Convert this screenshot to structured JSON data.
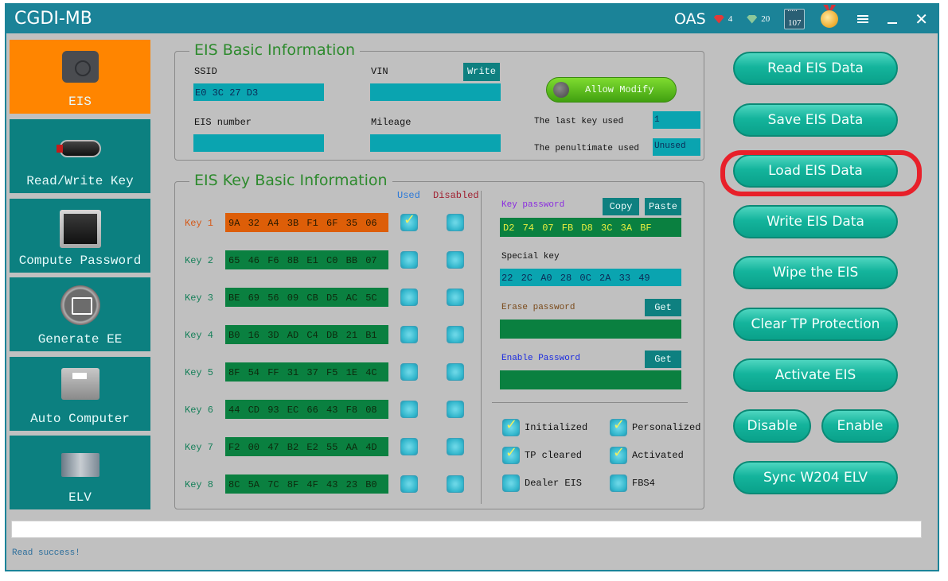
{
  "titlebar": {
    "title": "CGDI-MB",
    "account": "OAS",
    "red_gems": "4",
    "green_gems": "20",
    "calendar_days": "107"
  },
  "sidebar": {
    "items": [
      {
        "label": "EIS",
        "active": true
      },
      {
        "label": "Read/Write Key",
        "active": false
      },
      {
        "label": "Compute Password",
        "active": false
      },
      {
        "label": "Generate EE",
        "active": false
      },
      {
        "label": "Auto Computer",
        "active": false
      },
      {
        "label": "ELV",
        "active": false
      }
    ]
  },
  "basic_info": {
    "title": "EIS Basic Information",
    "ssid_label": "SSID",
    "ssid_value": "E0 3C 27 D3",
    "vin_label": "VIN",
    "vin_value": "",
    "write_button": "Write",
    "eis_number_label": "EIS number",
    "eis_number_value": "",
    "mileage_label": "Mileage",
    "mileage_value": "",
    "allow_modify": "Allow Modify",
    "last_key_label": "The last key used",
    "last_key_value": "1",
    "penultimate_label": "The penultimate used",
    "penultimate_value": "Unused"
  },
  "key_info": {
    "title": "EIS Key Basic Information",
    "used_header": "Used",
    "disabled_header": "Disabled",
    "keys": [
      {
        "label": "Key 1",
        "value": "9A 32 A4 3B F1 6F 35 06",
        "used": true,
        "disabled": false
      },
      {
        "label": "Key 2",
        "value": "65 46 F6 8B E1 C0 BB 07",
        "used": false,
        "disabled": false
      },
      {
        "label": "Key 3",
        "value": "BE 69 56 09 CB D5 AC 5C",
        "used": false,
        "disabled": false
      },
      {
        "label": "Key 4",
        "value": "B0 16 3D AD C4 DB 21 B1",
        "used": false,
        "disabled": false
      },
      {
        "label": "Key 5",
        "value": "8F 54 FF 31 37 F5 1E 4C",
        "used": false,
        "disabled": false
      },
      {
        "label": "Key 6",
        "value": "44 CD 93 EC 66 43 F8 08",
        "used": false,
        "disabled": false
      },
      {
        "label": "Key 7",
        "value": "F2 00 47 B2 E2 55 AA 4D",
        "used": false,
        "disabled": false
      },
      {
        "label": "Key 8",
        "value": "8C 5A 7C 8F 4F 43 23 B0",
        "used": false,
        "disabled": false
      }
    ],
    "key_password_label": "Key password",
    "copy_button": "Copy",
    "paste_button": "Paste",
    "key_password_value": "D2 74 07 FB D8 3C 3A BF",
    "special_key_label": "Special key",
    "special_key_value": "22 2C A0 28 0C 2A 33 49",
    "erase_password_label": "Erase password",
    "erase_get_button": "Get",
    "erase_password_value": "",
    "enable_password_label": "Enable Password",
    "enable_get_button": "Get",
    "enable_password_value": "",
    "flags": [
      {
        "label": "Initialized",
        "checked": true
      },
      {
        "label": "Personalized",
        "checked": true
      },
      {
        "label": "TP cleared",
        "checked": true
      },
      {
        "label": "Activated",
        "checked": true
      },
      {
        "label": "Dealer EIS",
        "checked": false
      },
      {
        "label": "FBS4",
        "checked": false
      }
    ]
  },
  "actions": {
    "read": "Read  EIS Data",
    "save": "Save EIS Data",
    "load": "Load EIS Data",
    "write": "Write EIS Data",
    "wipe": "Wipe the EIS",
    "clear_tp": "Clear TP Protection",
    "activate": "Activate EIS",
    "disable": "Disable",
    "enable": "Enable",
    "sync": "Sync W204 ELV"
  },
  "highlighted_action": "load",
  "status": {
    "message": "Read success!",
    "progress_percent": 0
  },
  "colors": {
    "titlebar": "#1b8398",
    "active_nav": "#ff8500",
    "nav": "#0c8080",
    "highlight_ring": "#e8202a"
  }
}
